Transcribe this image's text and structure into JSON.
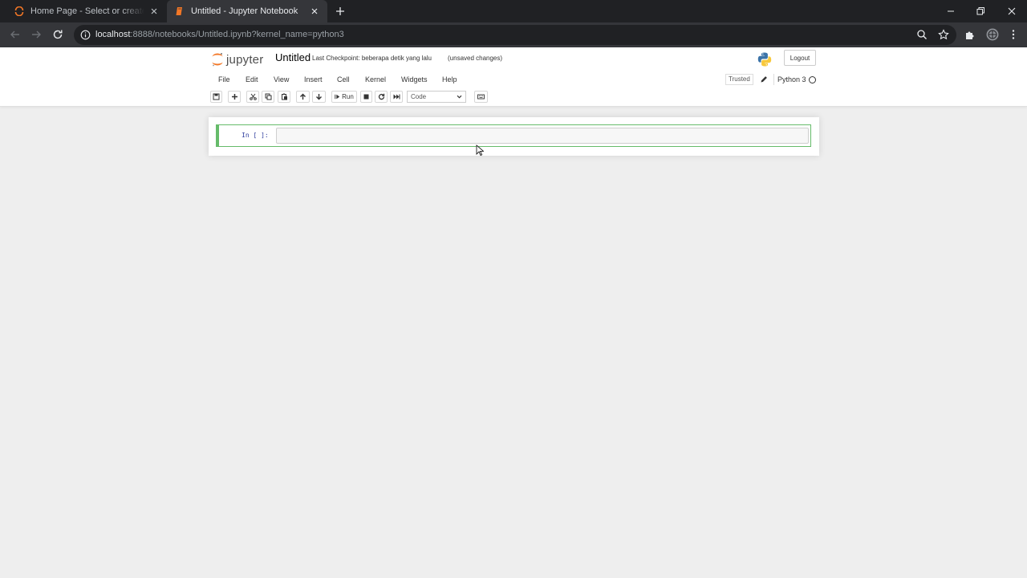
{
  "browser": {
    "tabs": [
      {
        "title": "Home Page - Select or create a notebook",
        "active": false
      },
      {
        "title": "Untitled - Jupyter Notebook",
        "active": true
      }
    ],
    "url": {
      "host": "localhost",
      "rest": ":8888/notebooks/Untitled.ipynb?kernel_name=python3"
    }
  },
  "jupyter": {
    "logo_text": "jupyter",
    "notebook_name": "Untitled",
    "checkpoint": "Last Checkpoint: beberapa detik yang lalu",
    "autosave_status": "(unsaved changes)",
    "logout_label": "Logout",
    "menu": [
      "File",
      "Edit",
      "View",
      "Insert",
      "Cell",
      "Kernel",
      "Widgets",
      "Help"
    ],
    "trusted_label": "Trusted",
    "kernel_name": "Python 3",
    "toolbar": {
      "run_label": "Run",
      "cell_type": "Code"
    }
  },
  "cell": {
    "prompt": "In [ ]:",
    "source": ""
  },
  "colors": {
    "accent_orange": "#f37726",
    "cell_border": "#66bb6a",
    "prompt_blue": "#303f9f"
  }
}
